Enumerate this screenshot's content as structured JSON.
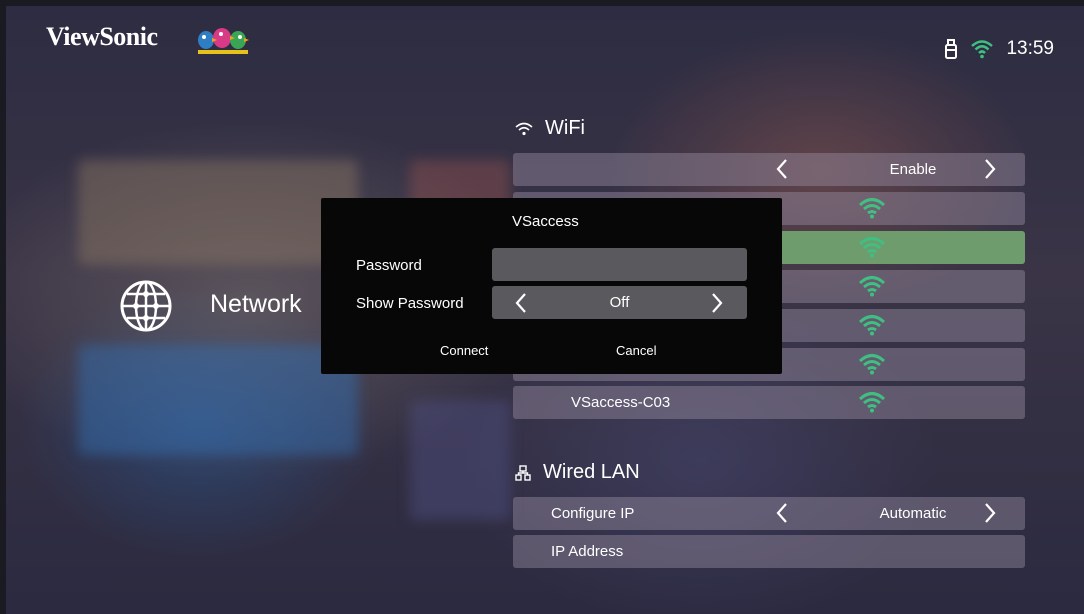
{
  "brand": {
    "logo_text": "ViewSonic"
  },
  "status_bar": {
    "time": "13:59",
    "icons": [
      "usb-storage-icon",
      "wifi-icon"
    ]
  },
  "sidebar": {
    "title": "Network",
    "icon": "globe-icon"
  },
  "wifi_section": {
    "title": "WiFi",
    "icon": "wifi-icon",
    "enable_row": {
      "value": "Enable"
    },
    "networks": [
      {
        "name": ""
      },
      {
        "name": ""
      },
      {
        "name": ""
      },
      {
        "name": ""
      },
      {
        "name": ""
      },
      {
        "name": "VSaccess-C03"
      }
    ]
  },
  "wired_section": {
    "title": "Wired LAN",
    "icon": "lan-icon",
    "configure_ip": {
      "label": "Configure IP",
      "value": "Automatic"
    },
    "ip_address": {
      "label": "IP Address"
    }
  },
  "dialog": {
    "title": "VSaccess",
    "password_label": "Password",
    "password_value": "",
    "show_password_label": "Show Password",
    "show_password_value": "Off",
    "connect_label": "Connect",
    "cancel_label": "Cancel"
  },
  "colors": {
    "selected_row": "#6f9c6c",
    "wifi_signal": "#3fbf82",
    "dialog_bg": "#070707"
  }
}
